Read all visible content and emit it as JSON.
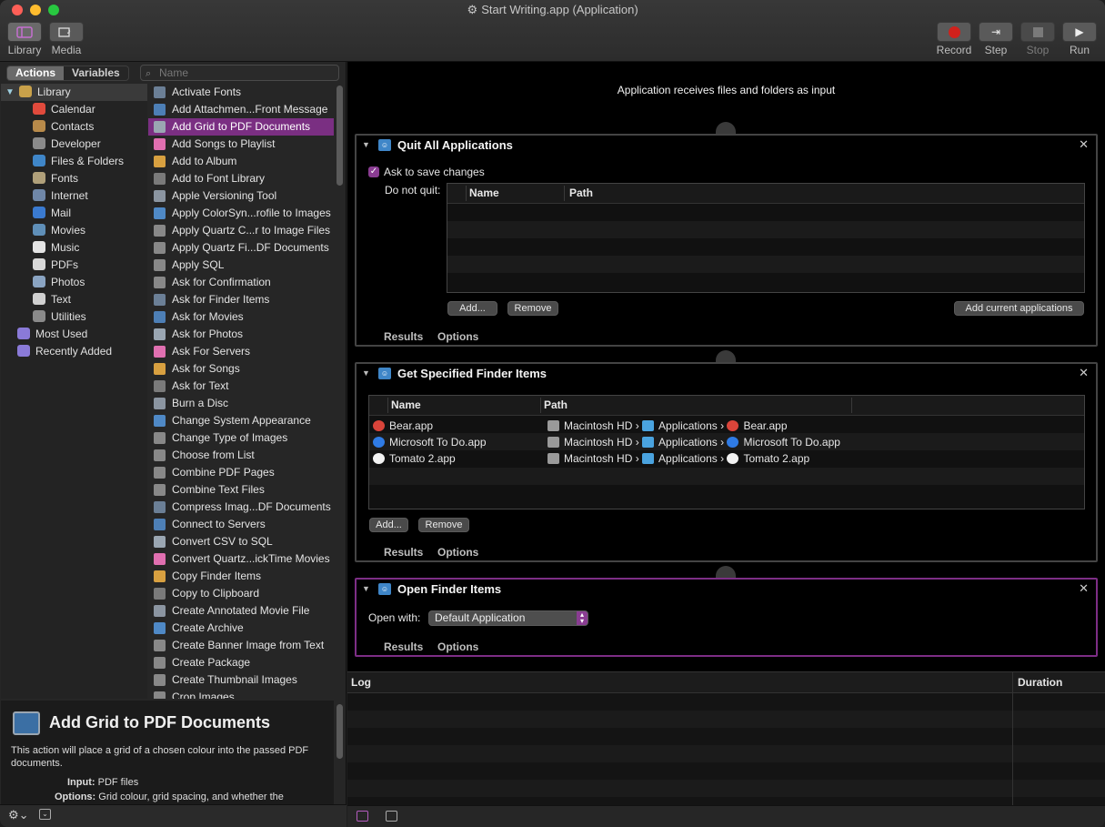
{
  "window": {
    "title": "Start Writing.app (Application)",
    "colors": {
      "close": "#fe5f57",
      "minimize": "#febc2e",
      "zoom": "#28c840",
      "accent": "#7d2e86"
    }
  },
  "toolbar": {
    "library": "Library",
    "media": "Media",
    "record": "Record",
    "step": "Step",
    "stop": "Stop",
    "run": "Run"
  },
  "tabs": {
    "actions": "Actions",
    "variables": "Variables"
  },
  "search": {
    "placeholder": "Name"
  },
  "library": [
    {
      "label": "Library",
      "icon": "library-icon",
      "color": "#c9a14a"
    },
    {
      "label": "Calendar",
      "icon": "calendar-icon",
      "color": "#e04a3c"
    },
    {
      "label": "Contacts",
      "icon": "contacts-icon",
      "color": "#b88a4a"
    },
    {
      "label": "Developer",
      "icon": "developer-icon",
      "color": "#8a8a8a"
    },
    {
      "label": "Files & Folders",
      "icon": "finder-icon",
      "color": "#3f86c8"
    },
    {
      "label": "Fonts",
      "icon": "fonts-icon",
      "color": "#b0a07a"
    },
    {
      "label": "Internet",
      "icon": "internet-icon",
      "color": "#6f87a8"
    },
    {
      "label": "Mail",
      "icon": "mail-icon",
      "color": "#3a7ad0"
    },
    {
      "label": "Movies",
      "icon": "movies-icon",
      "color": "#5f8fb8"
    },
    {
      "label": "Music",
      "icon": "music-icon",
      "color": "#e4e4e4"
    },
    {
      "label": "PDFs",
      "icon": "pdf-icon",
      "color": "#d8d8d8"
    },
    {
      "label": "Photos",
      "icon": "photos-icon",
      "color": "#8aa4c2"
    },
    {
      "label": "Text",
      "icon": "text-icon",
      "color": "#d0d0d0"
    },
    {
      "label": "Utilities",
      "icon": "utilities-icon",
      "color": "#8a8a8a"
    },
    {
      "label": "Most Used",
      "icon": "smart-folder-icon",
      "color": "#8a7ad8"
    },
    {
      "label": "Recently Added",
      "icon": "smart-folder-icon",
      "color": "#8a7ad8"
    }
  ],
  "actions": [
    "Activate Fonts",
    "Add Attachmen...Front Message",
    "Add Grid to PDF Documents",
    "Add Songs to Playlist",
    "Add to Album",
    "Add to Font Library",
    "Apple Versioning Tool",
    "Apply ColorSyn...rofile to Images",
    "Apply Quartz C...r to Image Files",
    "Apply Quartz Fi...DF Documents",
    "Apply SQL",
    "Ask for Confirmation",
    "Ask for Finder Items",
    "Ask for Movies",
    "Ask for Photos",
    "Ask For Servers",
    "Ask for Songs",
    "Ask for Text",
    "Burn a Disc",
    "Change System Appearance",
    "Change Type of Images",
    "Choose from List",
    "Combine PDF Pages",
    "Combine Text Files",
    "Compress Imag...DF Documents",
    "Connect to Servers",
    "Convert CSV to SQL",
    "Convert Quartz...ickTime Movies",
    "Copy Finder Items",
    "Copy to Clipboard",
    "Create Annotated Movie File",
    "Create Archive",
    "Create Banner Image from Text",
    "Create Package",
    "Create Thumbnail Images",
    "Crop Images"
  ],
  "selected_action": "Add Grid to PDF Documents",
  "description": {
    "title": "Add Grid to PDF Documents",
    "text": "This action will place a grid of a chosen colour into the passed PDF documents.",
    "input_label": "Input:",
    "input": "PDF files",
    "options_label": "Options:",
    "options": "Grid colour, grid spacing, and whether the"
  },
  "workflow": {
    "receives": "Application receives files and folders as input",
    "quit_all": {
      "title": "Quit All Applications",
      "ask_label": "Ask to save changes",
      "ask_checked": true,
      "do_not_quit_label": "Do not quit:",
      "col_name": "Name",
      "col_path": "Path",
      "add": "Add...",
      "remove": "Remove",
      "add_current": "Add current applications",
      "results": "Results",
      "options": "Options"
    },
    "get_items": {
      "title": "Get Specified Finder Items",
      "col_name": "Name",
      "col_path": "Path",
      "items": [
        {
          "name": "Bear.app",
          "hd": "Macintosh HD",
          "folder": "Applications",
          "app": "Bear.app",
          "color": "#d9443a"
        },
        {
          "name": "Microsoft To Do.app",
          "hd": "Macintosh HD",
          "folder": "Applications",
          "app": "Microsoft To Do.app",
          "color": "#2f7be5"
        },
        {
          "name": "Tomato 2.app",
          "hd": "Macintosh HD",
          "folder": "Applications",
          "app": "Tomato 2.app",
          "color": "#f2f2f2"
        }
      ],
      "sep": "›",
      "add": "Add...",
      "remove": "Remove",
      "results": "Results",
      "options": "Options"
    },
    "open_items": {
      "title": "Open Finder Items",
      "open_with_label": "Open with:",
      "open_with_value": "Default Application",
      "results": "Results",
      "options": "Options"
    }
  },
  "log": {
    "col_log": "Log",
    "col_duration": "Duration"
  }
}
